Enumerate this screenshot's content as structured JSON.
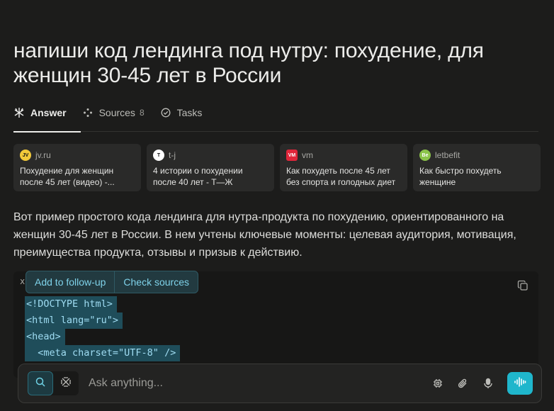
{
  "title": "напиши код лендинга под нутру: похудение, для женщин 30-45 лет в России",
  "tabs": [
    {
      "label": "Answer",
      "icon": "answer-icon"
    },
    {
      "label": "Sources",
      "count": "8",
      "icon": "sources-icon"
    },
    {
      "label": "Tasks",
      "icon": "tasks-icon"
    }
  ],
  "sources": [
    {
      "site": "jv.ru",
      "favicon_text": "JV",
      "favicon_color": "#f2c93a",
      "title_line1": "Похудение для женщин",
      "title_line2": "после 45 лет (видео) -..."
    },
    {
      "site": "t-j",
      "favicon_text": "T",
      "favicon_color": "#ffffff",
      "title_line1": "4 истории о похудении",
      "title_line2": "после 40 лет - Т—Ж"
    },
    {
      "site": "vm",
      "favicon_text": "VM",
      "favicon_color": "#e0263a",
      "title_line1": "Как похудеть после 45 лет",
      "title_line2": "без спорта и голодных диет"
    },
    {
      "site": "letbefit",
      "favicon_text": "Be",
      "favicon_color": "#8bc34a",
      "title_line1": "Как быстро похудеть",
      "title_line2": "женщине"
    }
  ],
  "answer": {
    "line1": "Вот пример простого кода лендинга для нутра-продукта по похудению, ориентированного на",
    "line2": "женщин 30-45 лет в России. В нем учтены ключевые моменты: целевая аудитория, мотивация,",
    "line3": "преимущества продукта, отзывы и призыв к действию."
  },
  "code": {
    "lang": "x",
    "lines": [
      "<!DOCTYPE html>",
      "<html lang=\"ru\">",
      "<head>",
      "  <meta charset=\"UTF-8\" />"
    ]
  },
  "popup": {
    "add_label": "Add to follow-up",
    "check_label": "Check sources"
  },
  "input": {
    "placeholder": "Ask anything..."
  },
  "colors": {
    "accent": "#1fb6cc",
    "background": "#1c1c1b",
    "selection": "#1f4d5a"
  }
}
